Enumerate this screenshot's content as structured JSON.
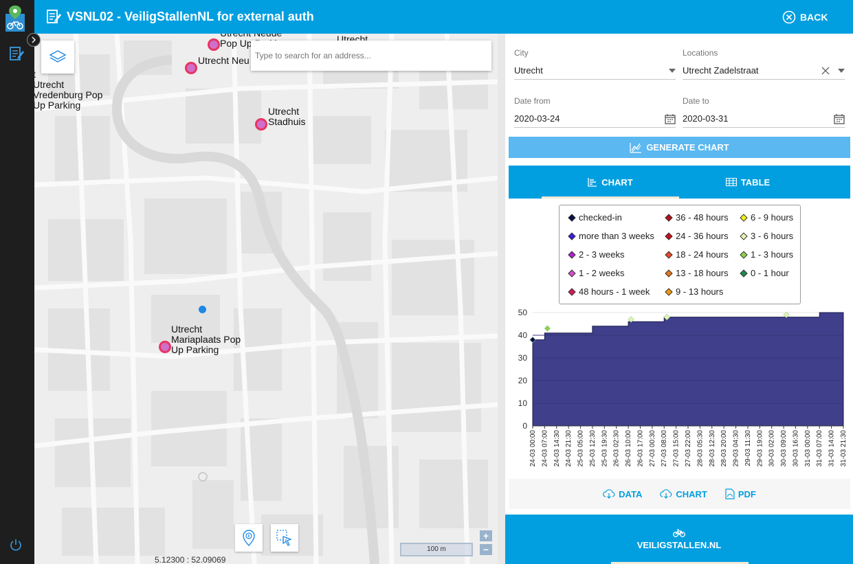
{
  "header": {
    "title": "VSNL02 - VeiligStallenNL for external auth",
    "back_label": "BACK"
  },
  "map": {
    "search_placeholder": "Type to search for an address...",
    "labels": {
      "neude": "Utrecht Neude\nPop Up Parking",
      "neu": "Utrecht Neu",
      "utrecht_top": "Utrecht",
      "vredenburg": "t\nUtrecht\nVredenburg Pop\nUp Parking",
      "stadhuis": "Utrecht\nStadhuis",
      "mariaplaats": "Utrecht\nMariaplaats Pop\nUp Parking"
    },
    "scale": "100 m",
    "coords": "5.12300 : 52.09069",
    "zoom_in": "+",
    "zoom_out": "−"
  },
  "form": {
    "city_label": "City",
    "city_value": "Utrecht",
    "locations_label": "Locations",
    "locations_value": "Utrecht Zadelstraat",
    "date_from_label": "Date from",
    "date_from_value": "2020-03-24",
    "date_to_label": "Date to",
    "date_to_value": "2020-03-31",
    "generate_label": "GENERATE CHART"
  },
  "tabs": {
    "chart": "CHART",
    "table": "TABLE"
  },
  "legend": [
    {
      "label": "checked-in",
      "color": "#0b0b45"
    },
    {
      "label": "more than 3 weeks",
      "color": "#3a1de0"
    },
    {
      "label": "2 - 3 weeks",
      "color": "#b11fcf"
    },
    {
      "label": "1 - 2 weeks",
      "color": "#d64ec9"
    },
    {
      "label": "48 hours - 1 week",
      "color": "#d8185f"
    },
    {
      "label": "36 - 48 hours",
      "color": "#b5121b"
    },
    {
      "label": "24 - 36 hours",
      "color": "#c8101e"
    },
    {
      "label": "18 - 24 hours",
      "color": "#e24a2a"
    },
    {
      "label": "13 - 18 hours",
      "color": "#e2781f"
    },
    {
      "label": "9 - 13 hours",
      "color": "#ef9b0f"
    },
    {
      "label": "6 - 9 hours",
      "color": "#f5ef1a"
    },
    {
      "label": "3 - 6 hours",
      "color": "#e5f3b4"
    },
    {
      "label": "1 - 3 hours",
      "color": "#8fd14f"
    },
    {
      "label": "0 - 1 hour",
      "color": "#1f8a4c"
    }
  ],
  "chart_data": {
    "type": "area",
    "ylim": [
      0,
      50
    ],
    "yticks": [
      0,
      10,
      20,
      30,
      40,
      50
    ],
    "x": [
      "24-03 00:00",
      "24-03 07:00",
      "24-03 14:30",
      "24-03 21:30",
      "25-03 05:00",
      "25-03 12:30",
      "25-03 19:30",
      "26-03 02:30",
      "26-03 10:00",
      "26-03 17:00",
      "27-03 00:30",
      "27-03 08:00",
      "27-03 15:00",
      "27-03 22:00",
      "28-03 05:30",
      "28-03 12:30",
      "28-03 20:00",
      "29-03 04:30",
      "29-03 11:30",
      "29-03 19:00",
      "30-03 02:00",
      "30-03 09:00",
      "30-03 16:30",
      "31-03 00:00",
      "31-03 07:00",
      "31-03 14:00",
      "31-03 21:30"
    ],
    "series": [
      {
        "name": "checked-in",
        "color": "#3f3f8c",
        "values": [
          38,
          41,
          41,
          41,
          41,
          44,
          44,
          44,
          46,
          46,
          46,
          48,
          48,
          48,
          48,
          48,
          48,
          48,
          48,
          48,
          48,
          48,
          48,
          48,
          50,
          50,
          50
        ]
      }
    ],
    "markers": [
      {
        "x": "24-03 00:00",
        "value": 38,
        "series": "checked-in"
      },
      {
        "x": "24-03 07:00",
        "value": 43,
        "series": "1 - 3 hours"
      },
      {
        "x": "26-03 10:00",
        "value": 47,
        "series": "3 - 6 hours"
      },
      {
        "x": "27-03 08:00",
        "value": 48,
        "series": "3 - 6 hours"
      },
      {
        "x": "30-03 09:00",
        "value": 49,
        "series": "3 - 6 hours"
      }
    ]
  },
  "actions": {
    "data": "DATA",
    "chart": "CHART",
    "pdf": "PDF"
  },
  "footer": {
    "label": "VEILIGSTALLEN.NL"
  }
}
